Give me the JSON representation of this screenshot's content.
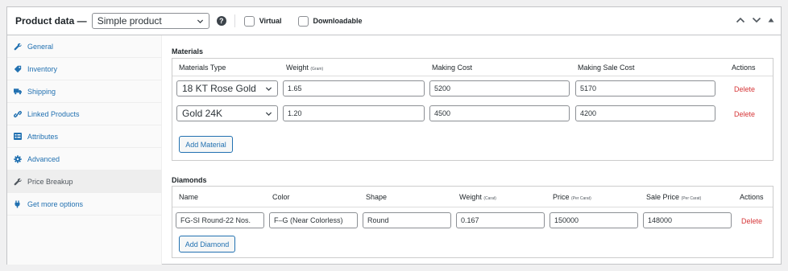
{
  "header": {
    "title": "Product data —",
    "product_type": "Simple product",
    "help": "?",
    "virtual_label": "Virtual",
    "downloadable_label": "Downloadable",
    "virtual_checked": false,
    "downloadable_checked": false
  },
  "sidebar": {
    "items": [
      {
        "label": "General",
        "icon": "wrench-icon"
      },
      {
        "label": "Inventory",
        "icon": "tag-icon"
      },
      {
        "label": "Shipping",
        "icon": "truck-icon"
      },
      {
        "label": "Linked Products",
        "icon": "link-icon"
      },
      {
        "label": "Attributes",
        "icon": "list-icon"
      },
      {
        "label": "Advanced",
        "icon": "gear-icon"
      },
      {
        "label": "Price Breakup",
        "icon": "wrench-icon",
        "active": true
      },
      {
        "label": "Get more options",
        "icon": "plugin-icon"
      }
    ]
  },
  "materials": {
    "title": "Materials",
    "columns": {
      "type": "Materials Type",
      "weight": "Weight",
      "weight_unit": "(Gram)",
      "making_cost": "Making Cost",
      "making_sale_cost": "Making Sale Cost",
      "actions": "Actions"
    },
    "rows": [
      {
        "type": "18 KT Rose Gold",
        "weight": "1.65",
        "making_cost": "5200",
        "making_sale_cost": "5170",
        "action": "Delete"
      },
      {
        "type": "Gold 24K",
        "weight": "1.20",
        "making_cost": "4500",
        "making_sale_cost": "4200",
        "action": "Delete"
      }
    ],
    "add_label": "Add Material"
  },
  "diamonds": {
    "title": "Diamonds",
    "columns": {
      "name": "Name",
      "color": "Color",
      "shape": "Shape",
      "weight": "Weight",
      "weight_unit": "(Carat)",
      "price": "Price",
      "price_unit": "(Per Carat)",
      "sale_price": "Sale Price",
      "sale_price_unit": "(Per Carat)",
      "actions": "Actions"
    },
    "rows": [
      {
        "name": "FG-SI Round-22 Nos.",
        "color": "F–G (Near Colorless)",
        "shape": "Round",
        "weight": "0.167",
        "price": "150000",
        "sale_price": "148000",
        "action": "Delete"
      }
    ],
    "add_label": "Add Diamond"
  },
  "colors": {
    "link": "#2271b1",
    "delete": "#d63638",
    "border": "#c3c4c7"
  }
}
